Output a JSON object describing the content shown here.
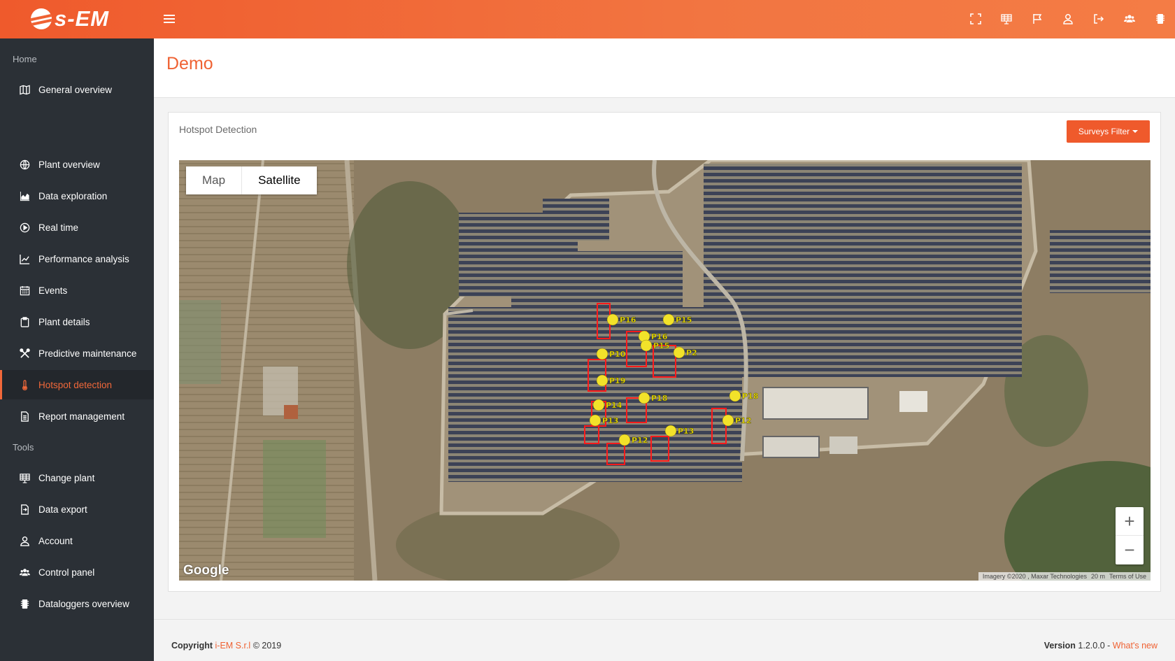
{
  "app": {
    "logo_text": "s-EM"
  },
  "topbar": {
    "icons": [
      "fullscreen-icon",
      "plant-grid-icon",
      "flag-icon",
      "user-icon",
      "logout-icon",
      "users-icon",
      "datalogger-icon"
    ]
  },
  "sidebar": {
    "section_home": "Home",
    "section_tools": "Tools",
    "items": [
      {
        "label": "General overview",
        "icon": "map-icon"
      },
      {
        "label": "Plant overview",
        "icon": "globe-icon"
      },
      {
        "label": "Data exploration",
        "icon": "area-chart-icon"
      },
      {
        "label": "Real time",
        "icon": "play-circle-icon"
      },
      {
        "label": "Performance analysis",
        "icon": "line-chart-icon"
      },
      {
        "label": "Events",
        "icon": "calendar-icon"
      },
      {
        "label": "Plant details",
        "icon": "clipboard-icon"
      },
      {
        "label": "Predictive maintenance",
        "icon": "tools-icon"
      },
      {
        "label": "Hotspot detection",
        "icon": "thermometer-icon",
        "active": true
      },
      {
        "label": "Report management",
        "icon": "file-icon"
      },
      {
        "label": "Change plant",
        "icon": "plant-grid-icon"
      },
      {
        "label": "Data export",
        "icon": "file-export-icon"
      },
      {
        "label": "Account",
        "icon": "user-icon"
      },
      {
        "label": "Control panel",
        "icon": "users-icon"
      },
      {
        "label": "Dataloggers overview",
        "icon": "datalogger-icon"
      }
    ]
  },
  "page": {
    "title": "Demo"
  },
  "card": {
    "title": "Hotspot Detection",
    "filter_button": "Surveys Filter"
  },
  "map": {
    "type_options": [
      "Map",
      "Satellite"
    ],
    "selected_type": "Satellite",
    "zoom_in": "+",
    "zoom_out": "−",
    "google_logo": "Google",
    "imagery_credit": "Imagery ©2020 , Maxar Technologies",
    "scale_label": "20 m",
    "terms": "Terms of Use",
    "markers": [
      "P16",
      "P15",
      "P16",
      "P15",
      "P10",
      "P2",
      "P19",
      "P18",
      "P18",
      "P14",
      "P13",
      "P12",
      "P13",
      "P12"
    ]
  },
  "footer": {
    "copyright_prefix": "Copyright",
    "company": "i-EM S.r.l",
    "copyright_suffix": "© 2019",
    "version_label": "Version",
    "version_number": "1.2.0.0 -",
    "whats_new": "What's new"
  }
}
